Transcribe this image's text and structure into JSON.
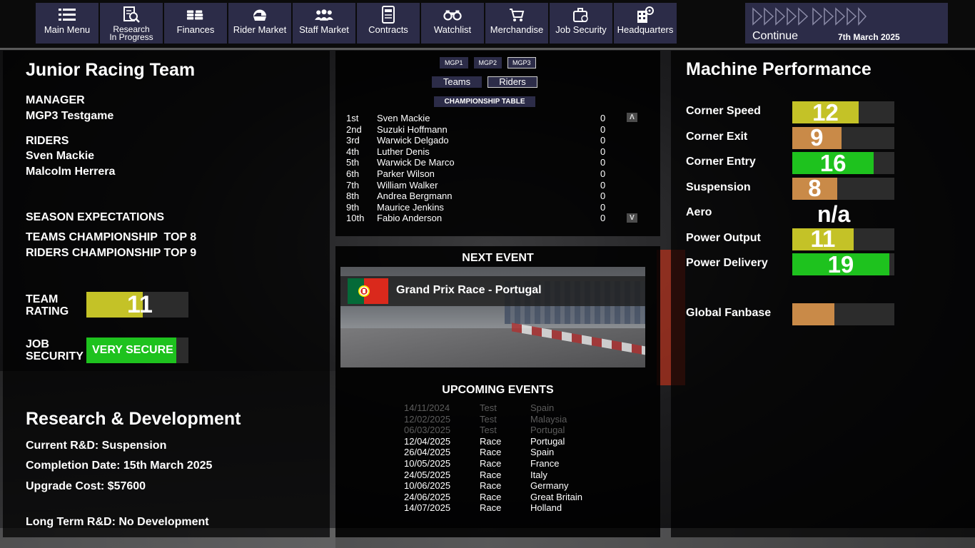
{
  "nav": {
    "items": [
      {
        "label": "Main Menu",
        "icon": "list-icon"
      },
      {
        "label": "Research\nIn Progress",
        "icon": "research-icon"
      },
      {
        "label": "Finances",
        "icon": "coins-icon"
      },
      {
        "label": "Rider Market",
        "icon": "helmet-icon"
      },
      {
        "label": "Staff Market",
        "icon": "people-icon"
      },
      {
        "label": "Contracts",
        "icon": "contract-icon"
      },
      {
        "label": "Watchlist",
        "icon": "binoculars-icon"
      },
      {
        "label": "Merchandise",
        "icon": "cart-icon"
      },
      {
        "label": "Job Security",
        "icon": "briefcase-icon"
      },
      {
        "label": "Headquarters",
        "icon": "building-icon"
      }
    ],
    "continue_label": "Continue",
    "date": "7th March 2025"
  },
  "team": {
    "name": "Junior Racing Team",
    "manager_heading": "MANAGER",
    "manager": "MGP3 Testgame",
    "riders_heading": "RIDERS",
    "riders": [
      "Sven Mackie",
      "Malcolm Herrera"
    ],
    "expectations_heading": "SEASON EXPECTATIONS",
    "teams_expectation": "TEAMS CHAMPIONSHIP  TOP 8",
    "riders_expectation": "RIDERS CHAMPIONSHIP TOP 9",
    "rating_label": "TEAM\nRATING",
    "rating": "11",
    "rating_fraction": 0.55,
    "job_security_label": "JOB\nSECURITY",
    "job_security": "VERY SECURE",
    "job_security_fraction": 0.88
  },
  "rnd": {
    "title": "Research & Development",
    "current": "Current R&D: Suspension",
    "completion": "Completion Date: 15th March 2025",
    "cost": "Upgrade Cost: $57600",
    "long_term": "Long Term R&D: No Development"
  },
  "championship": {
    "tiers": [
      "MGP1",
      "MGP2",
      "MGP3"
    ],
    "active_tier": "MGP3",
    "tabs": [
      "Teams",
      "Riders"
    ],
    "active_tab": "Riders",
    "table_title": "CHAMPIONSHIP TABLE",
    "rows": [
      {
        "pos": "1st",
        "name": "Sven Mackie",
        "pts": "0"
      },
      {
        "pos": "2nd",
        "name": "Suzuki Hoffmann",
        "pts": "0"
      },
      {
        "pos": "3rd",
        "name": "Warwick Delgado",
        "pts": "0"
      },
      {
        "pos": "4th",
        "name": "Luther Denis",
        "pts": "0"
      },
      {
        "pos": "5th",
        "name": "Warwick De Marco",
        "pts": "0"
      },
      {
        "pos": "6th",
        "name": "Parker Wilson",
        "pts": "0"
      },
      {
        "pos": "7th",
        "name": "William Walker",
        "pts": "0"
      },
      {
        "pos": "8th",
        "name": "Andrea Bergmann",
        "pts": "0"
      },
      {
        "pos": "9th",
        "name": "Maurice Jenkins",
        "pts": "0"
      },
      {
        "pos": "10th",
        "name": "Fabio Anderson",
        "pts": "0"
      }
    ],
    "scroll_up": "Λ",
    "scroll_down": "V"
  },
  "next_event": {
    "title": "NEXT EVENT",
    "name": "Grand Prix Race - Portugal",
    "flag": "portugal-flag"
  },
  "upcoming": {
    "title": "UPCOMING EVENTS",
    "events": [
      {
        "date": "14/11/2024",
        "type": "Test",
        "country": "Spain",
        "past": true
      },
      {
        "date": "12/02/2025",
        "type": "Test",
        "country": "Malaysia",
        "past": true
      },
      {
        "date": "06/03/2025",
        "type": "Test",
        "country": "Portugal",
        "past": true
      },
      {
        "date": "12/04/2025",
        "type": "Race",
        "country": "Portugal",
        "past": false
      },
      {
        "date": "26/04/2025",
        "type": "Race",
        "country": "Spain",
        "past": false
      },
      {
        "date": "10/05/2025",
        "type": "Race",
        "country": "France",
        "past": false
      },
      {
        "date": "24/05/2025",
        "type": "Race",
        "country": "Italy",
        "past": false
      },
      {
        "date": "10/06/2025",
        "type": "Race",
        "country": "Germany",
        "past": false
      },
      {
        "date": "24/06/2025",
        "type": "Race",
        "country": "Great Britain",
        "past": false
      },
      {
        "date": "14/07/2025",
        "type": "Race",
        "country": "Holland",
        "past": false
      }
    ]
  },
  "machine": {
    "title": "Machine Performance",
    "stats": [
      {
        "label": "Corner Speed",
        "value": "12",
        "fraction": 0.65,
        "color": "#c4c227"
      },
      {
        "label": "Corner Exit",
        "value": "9",
        "fraction": 0.48,
        "color": "#c98a48"
      },
      {
        "label": "Corner Entry",
        "value": "16",
        "fraction": 0.8,
        "color": "#1ec21e"
      },
      {
        "label": "Suspension",
        "value": "8",
        "fraction": 0.44,
        "color": "#c98a48"
      },
      {
        "label": "Aero",
        "value": "n/a",
        "fraction": null,
        "color": null
      },
      {
        "label": "Power Output",
        "value": "11",
        "fraction": 0.6,
        "color": "#c4c227"
      },
      {
        "label": "Power Delivery",
        "value": "19",
        "fraction": 0.95,
        "color": "#1ec21e"
      }
    ],
    "fanbase_label": "Global Fanbase",
    "fanbase_fraction": 0.41,
    "fanbase_color": "#c98a48"
  },
  "colors": {
    "nav_bg": "#2c2c48",
    "rating_yellow": "#c4c227",
    "secure_green": "#1ec21e"
  }
}
